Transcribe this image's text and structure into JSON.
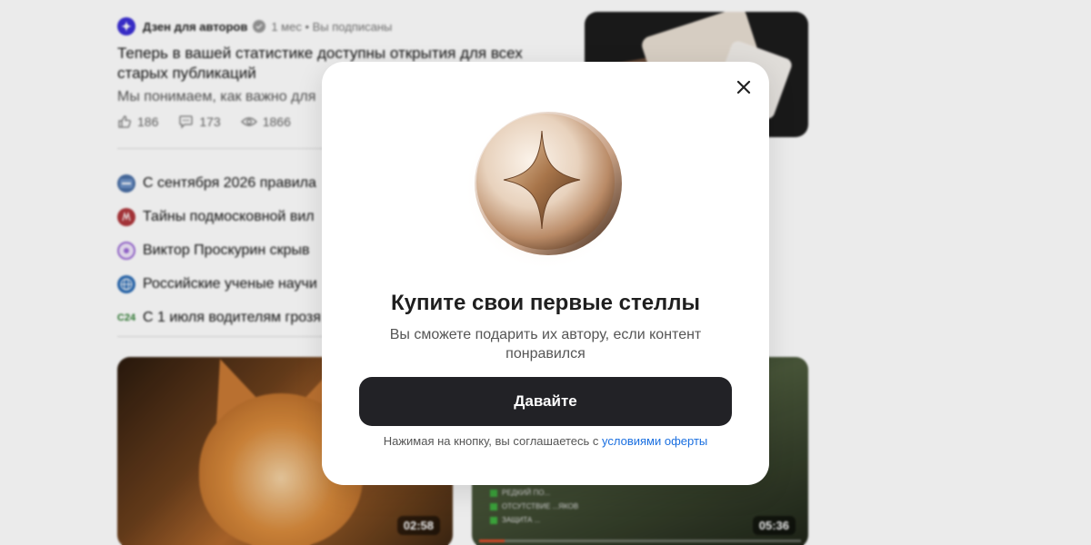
{
  "feed": {
    "post": {
      "channel_name": "Дзен для авторов",
      "meta": "1 мес • Вы подписаны",
      "title": "Теперь в вашей статистике доступны открытия для всех старых публикаций",
      "snippet": "Мы понимаем, как важно для",
      "likes": "186",
      "comments": "173",
      "views": "1866"
    },
    "news": [
      {
        "text": "С сентября 2026 правила",
        "icon_color": "#4a6fa5",
        "icon": "news-source-icon"
      },
      {
        "text": "Тайны подмосковной вил",
        "icon_color": "#b0373c",
        "icon": "news-source-icon"
      },
      {
        "text": "Виктор Проскурин скрыв",
        "icon_color": "#9c6bd6",
        "icon": "news-source-icon"
      },
      {
        "text": "Российские ученые научи",
        "icon_color": "#2d6db5",
        "icon": "globe-icon"
      },
      {
        "text": "С 1 июля водителям грозя",
        "icon_color": "#ffffff",
        "icon_label": "C24",
        "icon": "c24-icon"
      }
    ],
    "videos": {
      "left_duration": "02:58",
      "right_duration": "05:36",
      "right_checklist": [
        "РЕДКИЙ ПО...",
        "ОТСУТСТВИЕ ...ЯКОВ",
        "ЗАЩИТА ..."
      ],
      "right_progress": 0.08
    }
  },
  "modal": {
    "title": "Купите свои первые стеллы",
    "subtitle": "Вы сможете подарить их автору, если контент понравился",
    "cta_label": "Давайте",
    "terms_prefix": "Нажимая на кнопку, вы соглашаетесь с ",
    "terms_link": "условиями оферты"
  }
}
